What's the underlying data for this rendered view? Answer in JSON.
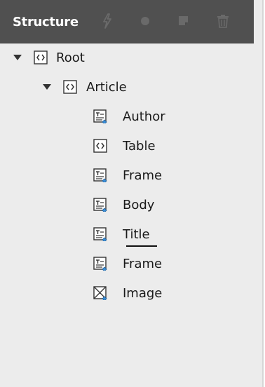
{
  "panel": {
    "title": "Structure",
    "tools": [
      {
        "name": "flash-icon"
      },
      {
        "name": "circle-icon"
      },
      {
        "name": "note-icon"
      },
      {
        "name": "trash-icon"
      }
    ]
  },
  "tree": {
    "root": "Root",
    "article": "Article",
    "children": [
      {
        "label": "Author",
        "icon": "text-frame-icon"
      },
      {
        "label": "Table",
        "icon": "element-icon"
      },
      {
        "label": "Frame",
        "icon": "text-frame-icon"
      },
      {
        "label": "Body",
        "icon": "text-frame-icon"
      },
      {
        "label": "Title",
        "icon": "text-frame-icon"
      },
      {
        "label": "Frame",
        "icon": "text-frame-icon"
      },
      {
        "label": "Image",
        "icon": "image-frame-icon"
      }
    ]
  },
  "colors": {
    "header_bg": "#505050",
    "panel_bg": "#ececec",
    "tool_icon": "#6a6a6a",
    "accent_blue": "#3a8fd8"
  }
}
